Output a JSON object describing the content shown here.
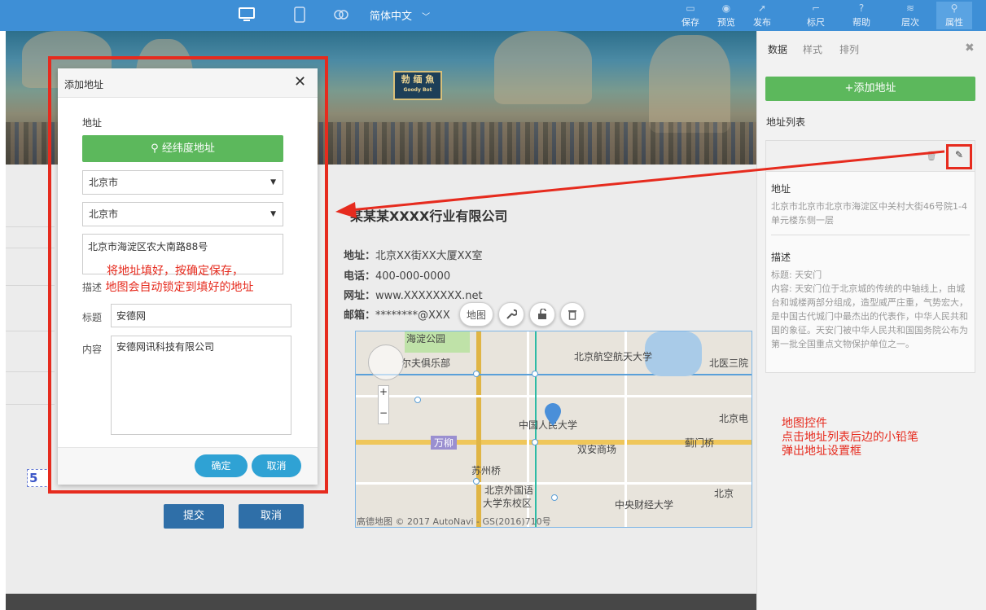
{
  "topbar": {
    "language": "简体中文",
    "actions": [
      {
        "label": "保存",
        "icon": "save-icon"
      },
      {
        "label": "预览",
        "icon": "eye-icon"
      },
      {
        "label": "发布",
        "icon": "send-icon"
      },
      {
        "label": "标尺",
        "icon": "ruler-icon"
      },
      {
        "label": "帮助",
        "icon": "help-icon"
      },
      {
        "label": "层次",
        "icon": "layers-icon"
      },
      {
        "label": "属性",
        "icon": "properties-icon"
      }
    ]
  },
  "banner": {
    "sign_text": "勃 缅 魚",
    "sign_sub": "Goody Bot"
  },
  "company": {
    "name": "某某某XXXX行业有限公司",
    "address_label": "地址：",
    "address": "北京XX街XX大厦XX室",
    "phone_label": "电话：",
    "phone": "400-000-0000",
    "web_label": "网址：",
    "web": "www.XXXXXXXX.net",
    "email_label": "邮箱：",
    "email": "********@XXX"
  },
  "map_tools": {
    "map_label": "地图",
    "wrench": "wrench-icon",
    "unlock": "unlock-icon",
    "trash": "trash-icon"
  },
  "map": {
    "labels": [
      "海淀公园",
      "北京航空航天大学",
      "北医三院",
      "尔夫俱乐部",
      "中国人民大学",
      "北京电",
      "万柳",
      "双安商场",
      "蓟门桥",
      "苏州桥",
      "北京外国语",
      "大学东校区",
      "中央财经大学",
      "北京"
    ],
    "copyright": "高德地图 © 2017 AutoNavi - GS(2016)710号"
  },
  "form_buttons": {
    "submit": "提交",
    "cancel": "取消"
  },
  "page_num": "5",
  "sidepanel": {
    "tabs": [
      "数据",
      "样式",
      "排列"
    ],
    "add_button": "+添加地址",
    "list_title": "地址列表",
    "card": {
      "address_h": "地址",
      "address": "北京市北京市北京市海淀区中关村大街46号院1-4单元楼东侧一层",
      "desc_h": "描述",
      "desc_title": "标题: 天安门",
      "desc_content": "内容: 天安门位于北京城的传统的中轴线上，由城台和城楼两部分组成，造型威严庄重，气势宏大，是中国古代城门中最杰出的代表作，中华人民共和国的象征。天安门被中华人民共和国国务院公布为第一批全国重点文物保护单位之一。"
    }
  },
  "dialog": {
    "title": "添加地址",
    "address_label": "地址",
    "latlng_button": "经纬度地址",
    "province": "北京市",
    "city": "北京市",
    "street": "北京市海淀区农大南路88号",
    "desc_label": "描述",
    "title_label": "标题",
    "title_value": "安德网",
    "content_label": "内容",
    "content_value": "安德网讯科技有限公司",
    "ok": "确定",
    "cancel": "取消"
  },
  "annotations": {
    "left_line1": "将地址填好，按确定保存，",
    "left_line2": "地图会自动锁定到填好的地址",
    "right_line1": "地图控件",
    "right_line2": "点击地址列表后边的小铅笔",
    "right_line3": "弹出地址设置框"
  },
  "colors": {
    "topbar": "#3e8fd6",
    "green": "#5cb85c",
    "highlight": "#e62b1e",
    "dialog_button": "#2fa2d4",
    "submit": "#2f6fa8"
  }
}
